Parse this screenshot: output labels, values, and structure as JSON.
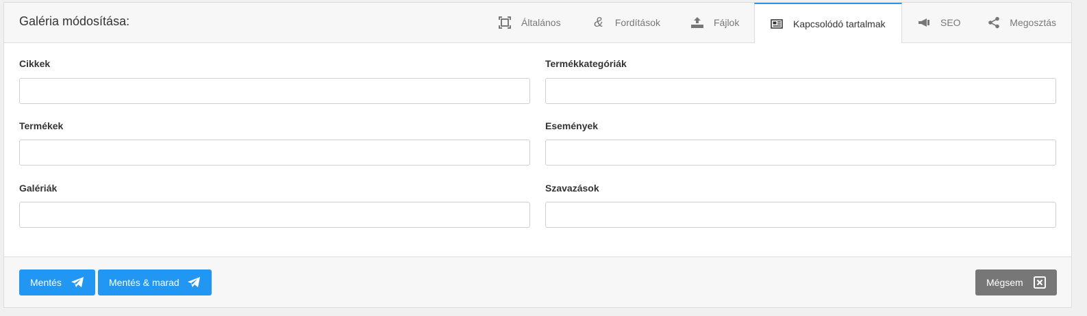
{
  "header": {
    "title": "Galéria módosítása:",
    "tabs": [
      {
        "label": "Általános",
        "icon": "expand-icon"
      },
      {
        "label": "Fordítások",
        "icon": "ampersand-icon"
      },
      {
        "label": "Fájlok",
        "icon": "upload-icon"
      },
      {
        "label": "Kapcsolódó tartalmak",
        "icon": "newspaper-icon",
        "active": true
      },
      {
        "label": "SEO",
        "icon": "megaphone-icon"
      },
      {
        "label": "Megosztás",
        "icon": "share-icon"
      }
    ]
  },
  "fields": {
    "cikkek": {
      "label": "Cikkek",
      "value": ""
    },
    "termekkategoriak": {
      "label": "Termékkategóriák",
      "value": ""
    },
    "termekek": {
      "label": "Termékek",
      "value": ""
    },
    "esemenyek": {
      "label": "Események",
      "value": ""
    },
    "galeriak": {
      "label": "Galériák",
      "value": ""
    },
    "szavazasok": {
      "label": "Szavazások",
      "value": ""
    }
  },
  "footer": {
    "save_label": "Mentés",
    "save_stay_label": "Mentés & marad",
    "cancel_label": "Mégsem"
  },
  "colors": {
    "accent": "#2196f3",
    "cancel": "#777777"
  }
}
